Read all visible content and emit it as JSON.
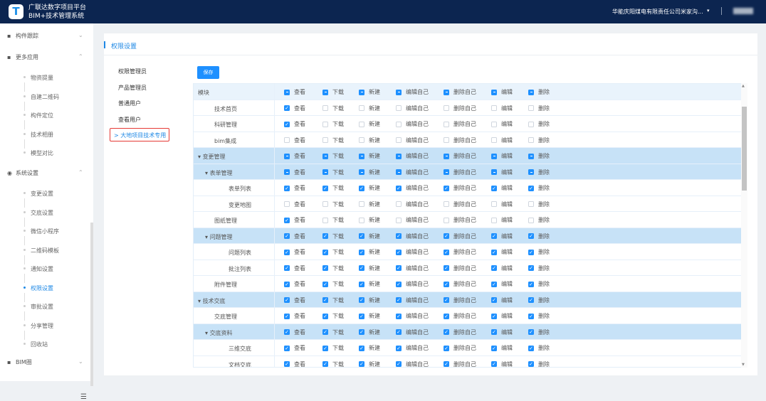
{
  "header": {
    "logo": "T",
    "title1": "广联达数字项目平台",
    "title2": "BIM+技术管理系统",
    "org": "华能庆阳煤电有限责任公司米家沟...",
    "org_caret": "▾"
  },
  "sidebar": {
    "groups": [
      {
        "label": "构件跟踪",
        "icon": "▪",
        "chev": "⌄"
      },
      {
        "label": "更多应用",
        "icon": "▪",
        "chev": "⌃"
      },
      {
        "label": "系统设置",
        "icon": "◉",
        "chev": "⌃"
      },
      {
        "label": "BIM圈",
        "icon": "▪",
        "chev": "⌄"
      }
    ],
    "more_apps": [
      "物资提量",
      "自建二维码",
      "构件定位",
      "技术相册",
      "模型对比"
    ],
    "settings": [
      "变更设置",
      "交底设置",
      "微信小程序",
      "二维码模板",
      "通知设置",
      "权限设置",
      "审批设置",
      "分享管理",
      "回收站"
    ],
    "active": "权限设置",
    "collapse_icon": "☰"
  },
  "page": {
    "title": "权限设置",
    "save": "保存",
    "roles": [
      "权限管理员",
      "产品管理员",
      "普通用户",
      "查看用户"
    ],
    "selected_role": "> 大地项目技术专用"
  },
  "table": {
    "module_header": "模块",
    "perms": [
      "查看",
      "下载",
      "新建",
      "编辑自己",
      "删除自己",
      "编辑",
      "删除"
    ],
    "header_state": "iiiiiii",
    "rows": [
      {
        "name": "技术首页",
        "level": 1,
        "state": "cuuuuuu"
      },
      {
        "name": "科研管理",
        "level": 1,
        "state": "cuuuuuu"
      },
      {
        "name": "bim集成",
        "level": 1,
        "state": "uuuuuuu"
      },
      {
        "name": "变更管理",
        "level": 0,
        "group": true,
        "state": "iiiiiii"
      },
      {
        "name": "表单管理",
        "level": 1,
        "group": true,
        "state": "iiiiiii"
      },
      {
        "name": "表单列表",
        "level": 2,
        "state": "ccccccc"
      },
      {
        "name": "变更地图",
        "level": 2,
        "state": "uuuuuuu"
      },
      {
        "name": "图纸管理",
        "level": 1,
        "state": "cuuuuuu"
      },
      {
        "name": "问题管理",
        "level": 1,
        "group": true,
        "state": "ccccccc"
      },
      {
        "name": "问题列表",
        "level": 2,
        "state": "ccccccc"
      },
      {
        "name": "批注列表",
        "level": 2,
        "state": "ccccccc"
      },
      {
        "name": "附件管理",
        "level": 1,
        "state": "ccccccc"
      },
      {
        "name": "技术交底",
        "level": 0,
        "group": true,
        "state": "ccccccc"
      },
      {
        "name": "交底管理",
        "level": 1,
        "state": "ccccccc"
      },
      {
        "name": "交底资料",
        "level": 1,
        "group": true,
        "state": "ccccccc"
      },
      {
        "name": "三维交底",
        "level": 2,
        "state": "ccccccc"
      },
      {
        "name": "文档交底",
        "level": 2,
        "state": "ccccccc"
      }
    ]
  },
  "colors": {
    "accent": "#1e90ff",
    "topbar": "#0c2550",
    "group_row": "#c7e2f7"
  }
}
